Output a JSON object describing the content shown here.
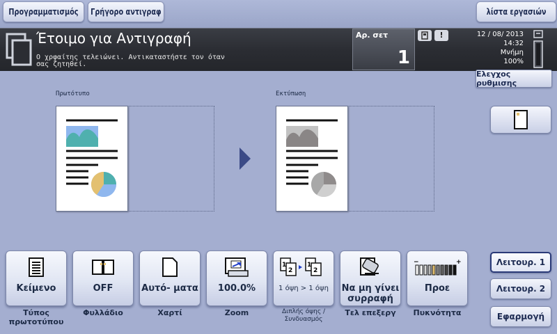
{
  "top_bar": {
    "programming": "Προγραμματισμός",
    "quick_copy": "Γρήγορο αντιγραφ",
    "job_list": "λίστα εργασιών"
  },
  "status": {
    "title": "Έτοιμο για Αντιγραφή",
    "message": "Ο χρφαίτης τελειώνει. Αντικαταστήστε τον όταν\nσας ζητηθεί.",
    "sets_label": "Αρ. σετ",
    "sets_value": "1",
    "date": "12 / 08/ 2013",
    "time": "14:32",
    "memory_label": "Μνήμη",
    "memory_value": "100%"
  },
  "check_settings": "Ελεγχος ρυθμισης",
  "preview": {
    "original_label": "Πρωτότυπο",
    "output_label": "Εκτύπωση"
  },
  "functions": [
    {
      "value": "Κείμενο",
      "caption": "Τύπος\nπρωτοτύπου",
      "icon": "text-document-icon"
    },
    {
      "value": "OFF",
      "caption": "Φυλλάδιο",
      "icon": "booklet-icon"
    },
    {
      "value": "Αυτό- ματα",
      "caption": "Χαρτί",
      "icon": "paper-icon"
    },
    {
      "value": "100.0%",
      "caption": "Zoom",
      "icon": "zoom-icon"
    },
    {
      "value": "1 όψη > 1 όψη",
      "caption": "Διπλής όψης / Συνδυασμός",
      "icon": "duplex-icon"
    },
    {
      "value": "Να μη γίνει συρραφή",
      "caption": "Τελ επεξεργ",
      "icon": "finishing-icon"
    },
    {
      "value": "Προε",
      "caption": "Πυκνότητα",
      "icon": "density-icon"
    }
  ],
  "side": {
    "function1": "Λειτουρ. 1",
    "function2": "Λειτουρ. 2",
    "apply": "Εφαρμογή"
  },
  "colors": {
    "background": "#a4aed0",
    "status_band": "#2b2d33",
    "accent_blue": "#8fb7ee",
    "teal": "#4fb0ae",
    "gold": "#e3c070"
  }
}
